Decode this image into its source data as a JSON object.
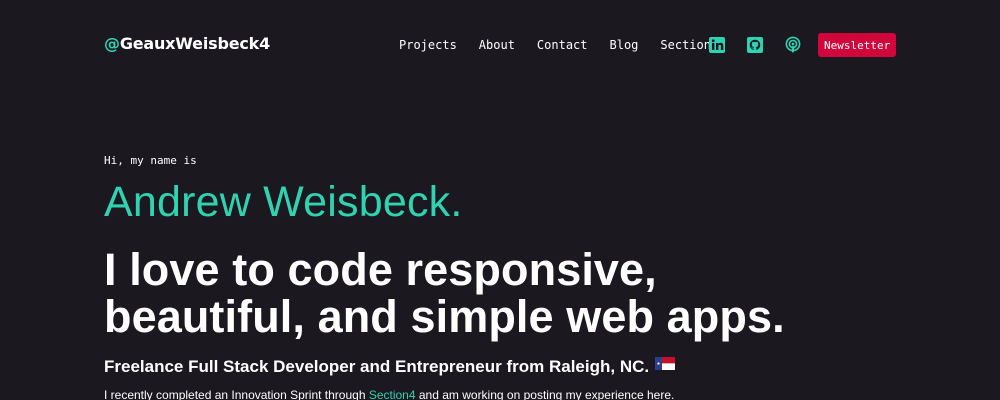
{
  "header": {
    "logo_prefix": "@",
    "logo_name": "GeauxWeisbeck4",
    "nav": [
      {
        "label": "Projects"
      },
      {
        "label": "About"
      },
      {
        "label": "Contact"
      },
      {
        "label": "Blog"
      },
      {
        "label": "Section 4"
      }
    ],
    "social_icons": [
      "linkedin-icon",
      "github-icon",
      "podcast-icon"
    ],
    "newsletter_label": "Newsletter"
  },
  "hero": {
    "intro": "Hi, my name is",
    "name": "Andrew Weisbeck.",
    "tagline_line1": "I love to code responsive,",
    "tagline_line2": "beautiful, and simple web apps.",
    "subtitle": "Freelance Full Stack Developer and Entrepreneur from Raleigh, NC.",
    "flag_icon": "north-carolina-flag-icon",
    "body_before": "I recently completed an Innovation Sprint through ",
    "body_link": "Section4",
    "body_after": " and am working on posting my experience here."
  },
  "colors": {
    "background": "#1b1820",
    "accent": "#2fd3b2",
    "button": "#d1063a",
    "text": "#ffffff"
  }
}
